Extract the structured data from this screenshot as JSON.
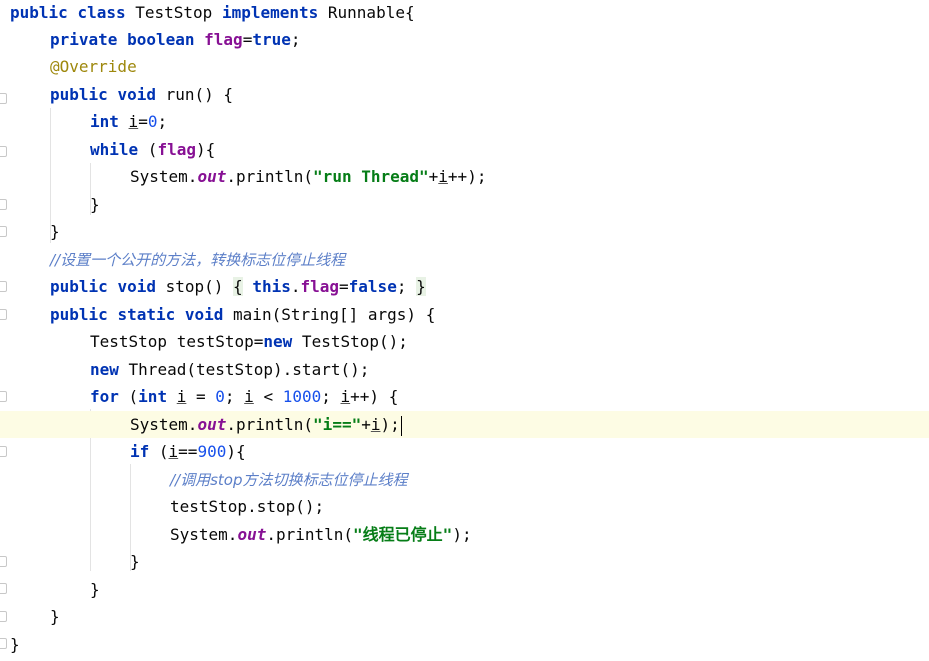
{
  "editor": {
    "language": "java",
    "current_line": 16,
    "lines": [
      [
        "public",
        " ",
        "class",
        " TestStop ",
        "implements",
        " Runnable{"
      ],
      [
        "private",
        " ",
        "boolean",
        " ",
        "flag",
        "=",
        "true",
        ";"
      ],
      [
        "@Override"
      ],
      [
        "public",
        " ",
        "void",
        " run() {"
      ],
      [
        "int",
        " ",
        "i",
        "=",
        "0",
        ";"
      ],
      [
        "while",
        " (",
        "flag",
        "){"
      ],
      [
        "System.",
        "out",
        ".println(",
        "\"run Thread\"",
        "+",
        "i",
        "++);"
      ],
      [
        "}"
      ],
      [
        "}"
      ],
      [
        "//设置一个公开的方法，转换标志位停止线程"
      ],
      [
        "public",
        " ",
        "void",
        " stop() ",
        "{",
        " ",
        "this",
        ".",
        "flag",
        "=",
        "false",
        "; ",
        "}"
      ],
      [
        "public",
        " ",
        "static",
        " ",
        "void",
        " main(String[] args) {"
      ],
      [
        "TestStop testStop=",
        "new",
        " TestStop();"
      ],
      [
        "new",
        " Thread(testStop).start();"
      ],
      [
        "for",
        " (",
        "int",
        " ",
        "i",
        " = ",
        "0",
        "; ",
        "i",
        " < ",
        "1000",
        "; ",
        "i",
        "++) {"
      ],
      [
        "System.",
        "out",
        ".println(",
        "\"i==\"",
        "+",
        "i",
        ");"
      ],
      [
        "if",
        " (",
        "i",
        "==",
        "900",
        "){"
      ],
      [
        "//调用stop方法切换标志位停止线程"
      ],
      [
        "testStop.stop();"
      ],
      [
        "System.",
        "out",
        ".println(",
        "\"线程已停止\"",
        ");"
      ],
      [
        "}"
      ],
      [
        "}"
      ],
      [
        "}"
      ],
      [
        "}"
      ]
    ]
  }
}
